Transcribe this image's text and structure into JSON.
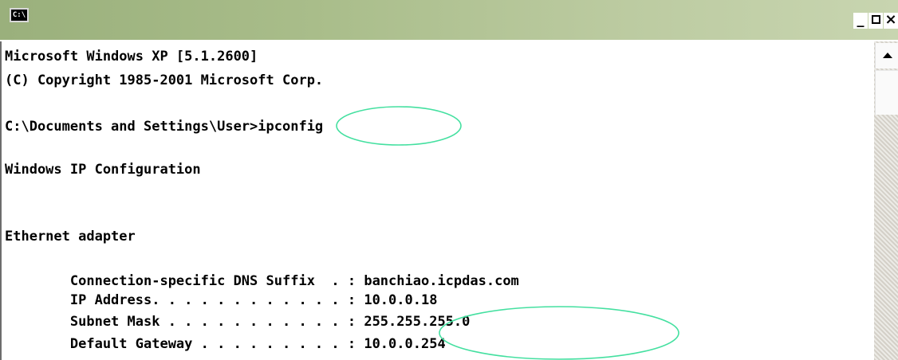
{
  "window": {
    "icon_text": "C:\\",
    "controls": {
      "minimize": "_",
      "maximize": "□",
      "close": "×"
    }
  },
  "console": {
    "lines": [
      "Microsoft Windows XP [5.1.2600]",
      "(C) Copyright 1985-2001 Microsoft Corp.",
      "",
      "C:\\Documents and Settings\\User>ipconfig",
      "",
      "Windows IP Configuration",
      "",
      "",
      "Ethernet adapter",
      "",
      "        Connection-specific DNS Suffix  . : banchiao.icpdas.com",
      "        IP Address. . . . . . . . . . . . : 10.0.0.18",
      "        Subnet Mask . . . . . . . . . . . : 255.255.255.0",
      "        Default Gateway . . . . . . . . . : 10.0.0.254"
    ]
  },
  "colors": {
    "annotation": "#44e0a0",
    "titlebar": "#a9bd8a"
  }
}
